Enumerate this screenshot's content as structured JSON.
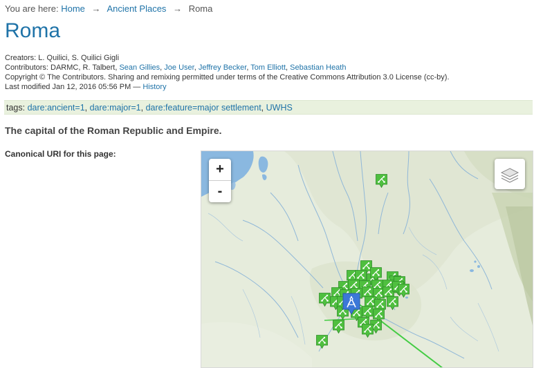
{
  "breadcrumb": {
    "prefix": "You are here:",
    "home": "Home",
    "section": "Ancient Places",
    "current": "Roma",
    "separator": "→"
  },
  "title": "Roma",
  "creators": "Creators: L. Quilici, S. Quilici Gigli",
  "contributors": {
    "prefix": "Contributors: DARMC, R. Talbert,",
    "links": [
      "Sean Gillies",
      "Joe User",
      "Jeffrey Becker",
      "Tom Elliott",
      "Sebastian Heath"
    ]
  },
  "copyright": "Copyright © The Contributors. Sharing and remixing permitted under terms of the Creative Commons Attribution 3.0 License (cc-by).",
  "last_modified": {
    "text": "Last modified Jan 12, 2016 05:56 PM —",
    "history": "History"
  },
  "tags": {
    "label": "tags:",
    "items": [
      "dare:ancient=1",
      "dare:major=1",
      "dare:feature=major settlement",
      "UWHS"
    ]
  },
  "description": "The capital of the Roman Republic and Empire.",
  "canonical_label": "Canonical URI for this page:",
  "map": {
    "zoom_in": "+",
    "zoom_out": "-",
    "marker_icon": "settlement-marker-icon",
    "primary_icon": "compass-marker-icon",
    "colors": {
      "marker": "#4fbf3f",
      "primary_marker": "#3c78d8",
      "water": "#8ab8e0",
      "line": "#44cc44"
    }
  }
}
